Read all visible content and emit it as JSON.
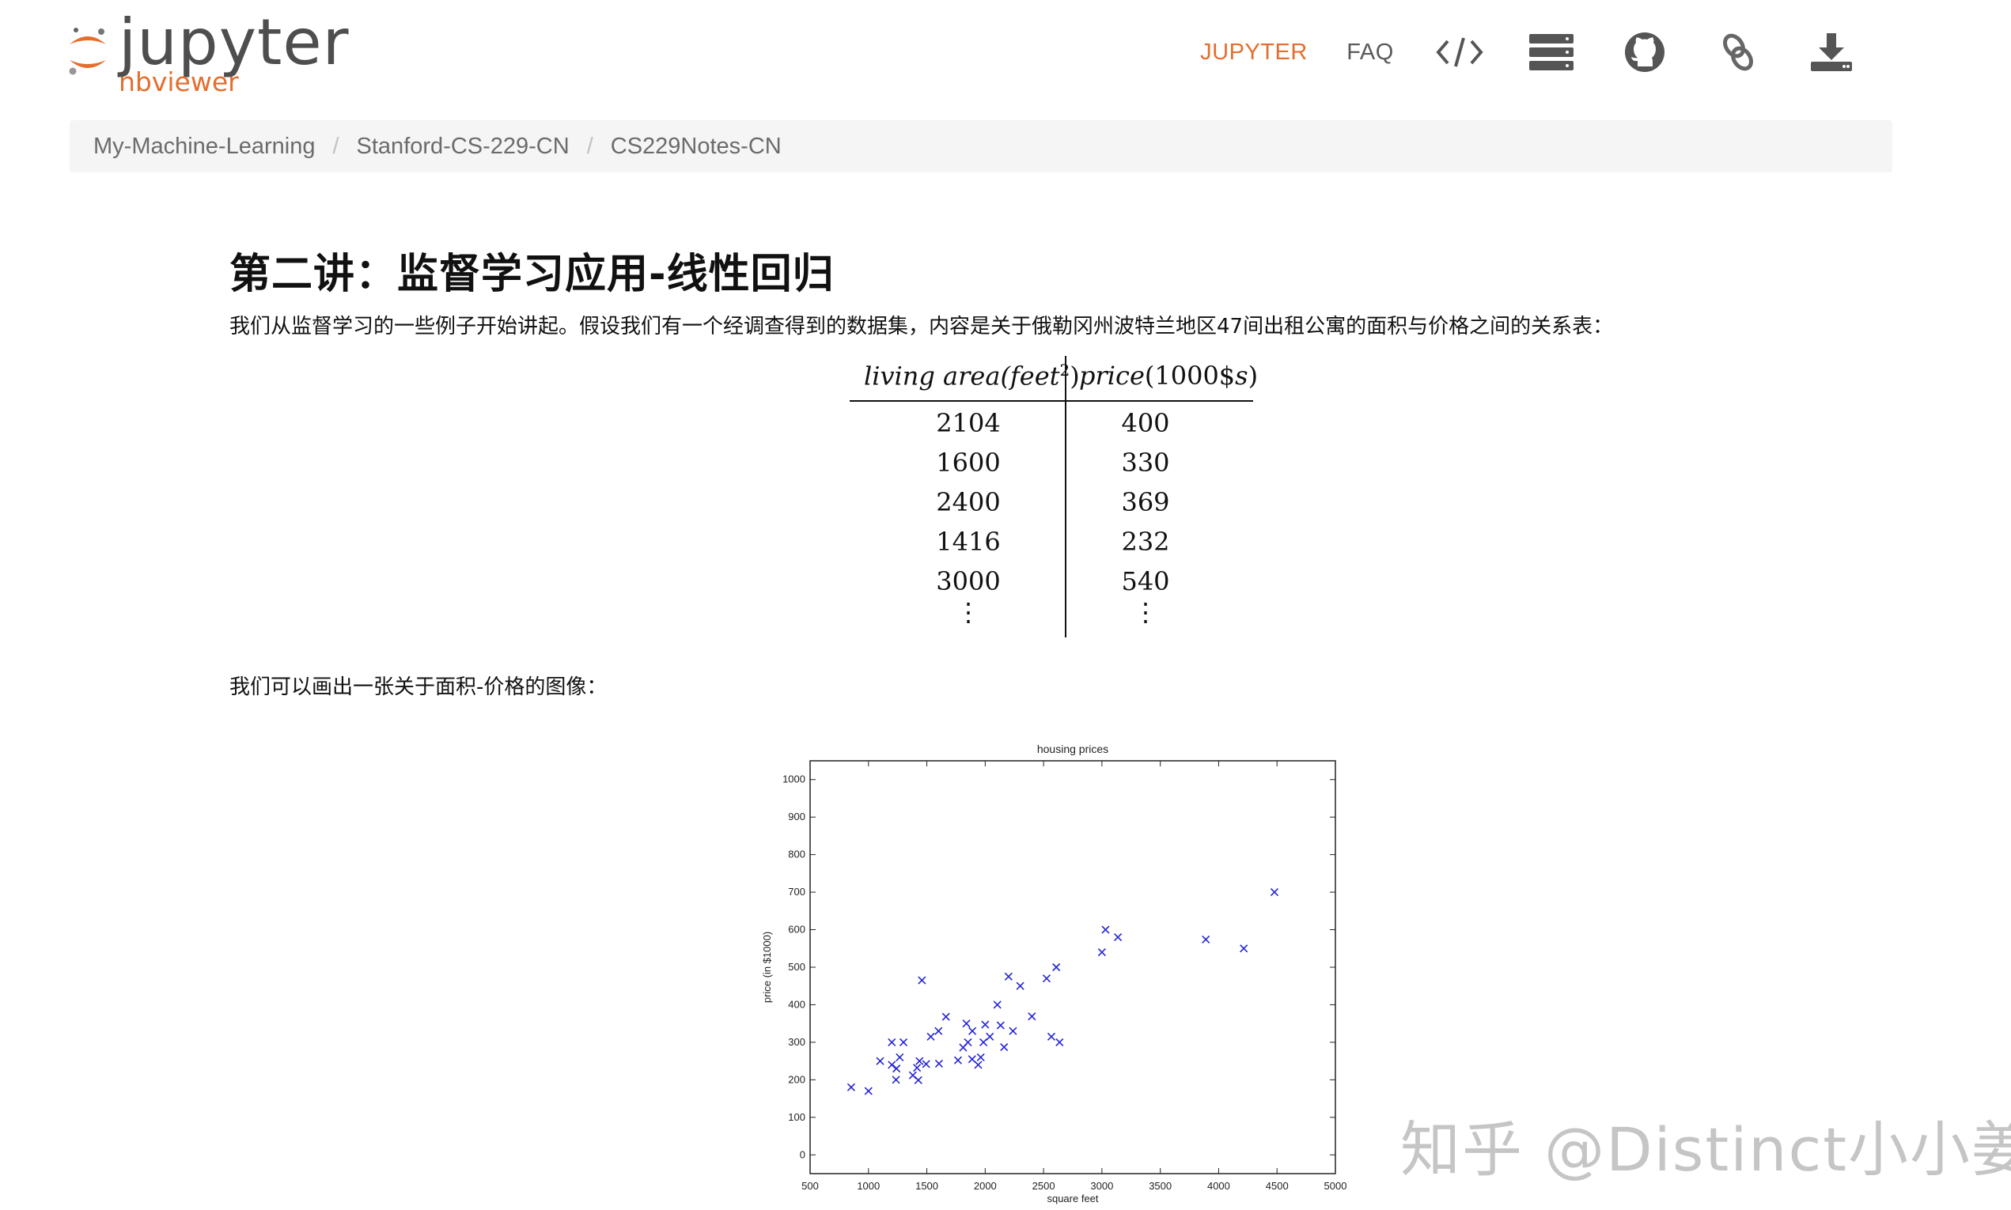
{
  "header": {
    "logo_text": "jupyter",
    "logo_subtext": "nbviewer",
    "nav": {
      "jupyter": "JUPYTER",
      "faq": "FAQ",
      "icons": [
        "code-icon",
        "server-icon",
        "github-icon",
        "link-icon",
        "download-icon"
      ]
    }
  },
  "breadcrumb": [
    "My-Machine-Learning",
    "Stanford-CS-229-CN",
    "CS229Notes-CN"
  ],
  "content": {
    "title": "第二讲：监督学习应用-线性回归",
    "intro": "我们从监督学习的一些例子开始讲起。假设我们有一个经调查得到的数据集，内容是关于俄勒冈州波特兰地区47间出租公寓的面积与价格之间的关系表：",
    "table": {
      "header_left": "living area(feet",
      "header_left_sup": "2",
      "header_left_close": ")",
      "header_right_main": "price",
      "header_right_paren": "(1000$",
      "header_right_s": "s",
      "header_right_close": ")",
      "rows": [
        [
          "2104",
          "400"
        ],
        [
          "1600",
          "330"
        ],
        [
          "2400",
          "369"
        ],
        [
          "1416",
          "232"
        ],
        [
          "3000",
          "540"
        ]
      ],
      "ellipsis": "⋮"
    },
    "plot_intro": "我们可以画出一张关于面积-价格的图像："
  },
  "chart_data": {
    "type": "scatter",
    "title": "housing prices",
    "xlabel": "square feet",
    "ylabel": "price (in $1000)",
    "xlim": [
      500,
      5000
    ],
    "ylim": [
      -50,
      1050
    ],
    "xticks": [
      500,
      1000,
      1500,
      2000,
      2500,
      3000,
      3500,
      4000,
      4500,
      5000
    ],
    "yticks": [
      0,
      100,
      200,
      300,
      400,
      500,
      600,
      700,
      800,
      900,
      1000
    ],
    "marker": "x",
    "color": "#2424d6",
    "points": [
      [
        852,
        180
      ],
      [
        1000,
        170
      ],
      [
        1100,
        250
      ],
      [
        1200,
        300
      ],
      [
        1200,
        240
      ],
      [
        1236,
        200
      ],
      [
        1240,
        230
      ],
      [
        1268,
        260
      ],
      [
        1300,
        300
      ],
      [
        1380,
        212
      ],
      [
        1416,
        232
      ],
      [
        1427,
        199
      ],
      [
        1437,
        250
      ],
      [
        1458,
        465
      ],
      [
        1494,
        242
      ],
      [
        1534,
        315
      ],
      [
        1600,
        330
      ],
      [
        1604,
        243
      ],
      [
        1664,
        368
      ],
      [
        1767,
        252
      ],
      [
        1811,
        286
      ],
      [
        1839,
        350
      ],
      [
        1852,
        300
      ],
      [
        1888,
        255
      ],
      [
        1890,
        330
      ],
      [
        1940,
        240
      ],
      [
        1962,
        260
      ],
      [
        1985,
        300
      ],
      [
        2000,
        347
      ],
      [
        2040,
        315
      ],
      [
        2104,
        400
      ],
      [
        2132,
        345
      ],
      [
        2162,
        287
      ],
      [
        2200,
        475
      ],
      [
        2238,
        330
      ],
      [
        2300,
        450
      ],
      [
        2400,
        369
      ],
      [
        2526,
        470
      ],
      [
        2567,
        315
      ],
      [
        2609,
        500
      ],
      [
        2637,
        300
      ],
      [
        3000,
        540
      ],
      [
        3031,
        600
      ],
      [
        3137,
        580
      ],
      [
        3890,
        574
      ],
      [
        4215,
        550
      ],
      [
        4478,
        700
      ]
    ]
  },
  "watermark": "知乎 @Distinct小小姜"
}
